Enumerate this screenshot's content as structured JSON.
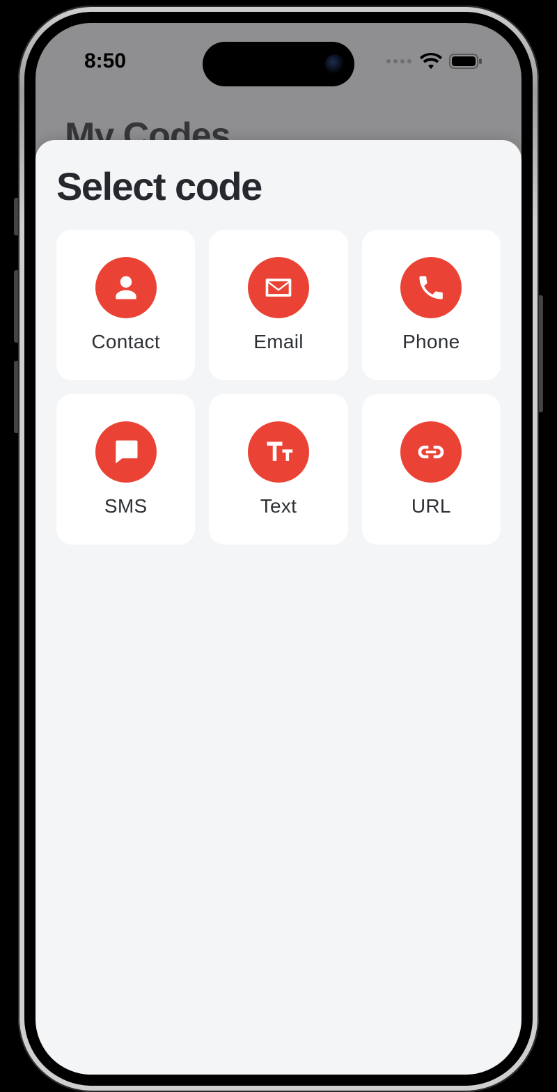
{
  "statusbar": {
    "time": "8:50"
  },
  "background": {
    "page_title": "My Codes"
  },
  "sheet": {
    "title": "Select code",
    "options": [
      {
        "label": "Contact",
        "icon": "contact-icon"
      },
      {
        "label": "Email",
        "icon": "email-icon"
      },
      {
        "label": "Phone",
        "icon": "phone-icon"
      },
      {
        "label": "SMS",
        "icon": "sms-icon"
      },
      {
        "label": "Text",
        "icon": "text-icon"
      },
      {
        "label": "URL",
        "icon": "url-icon"
      }
    ]
  },
  "colors": {
    "accent": "#ea4335",
    "sheet_bg": "#f4f5f7",
    "card_bg": "#ffffff"
  }
}
